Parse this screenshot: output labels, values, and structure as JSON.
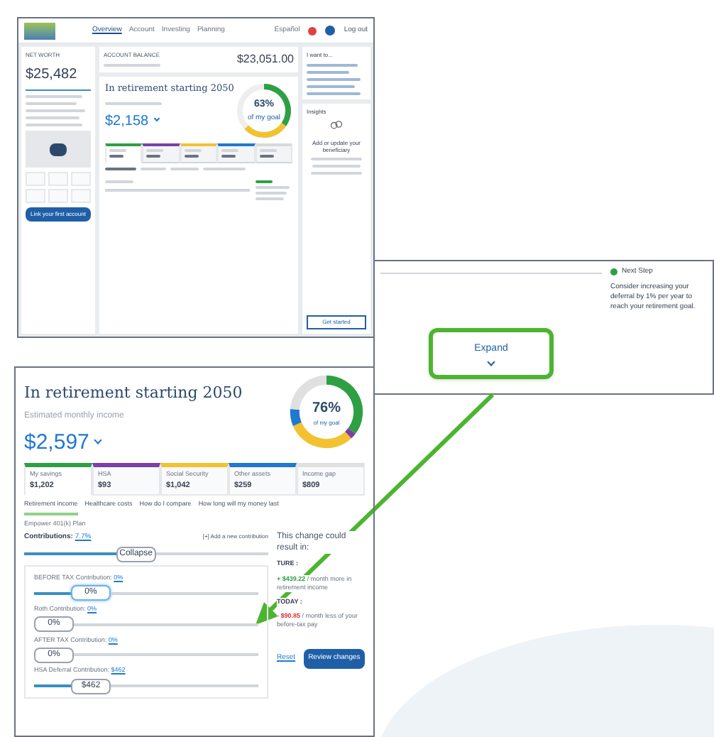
{
  "top_screenshot": {
    "nav": [
      {
        "label": "Overview",
        "selected": true
      },
      {
        "label": "Account",
        "selected": false
      },
      {
        "label": "Investing",
        "selected": false
      },
      {
        "label": "Planning",
        "selected": false
      }
    ],
    "language": "Español",
    "logout": "Log out",
    "net_worth": {
      "label": "NET WORTH",
      "value": "$25,482"
    },
    "link_button": "Link your first account",
    "balance": {
      "label": "ACCOUNT BALANCE",
      "value": "$23,051.00"
    },
    "retirement": {
      "title": "In retirement starting 2050",
      "amount": "$2,158",
      "percent": "63%",
      "goal": "of my goal"
    },
    "summary_tabs": [
      {
        "color": "#2ea043",
        "selected": true
      },
      {
        "color": "#7b3fa8",
        "selected": false
      },
      {
        "color": "#f2c230",
        "selected": false
      },
      {
        "color": "#1f78d1",
        "selected": false
      },
      {
        "color": "#d9d9d9",
        "selected": false
      }
    ],
    "side": {
      "want_title": "I want to...",
      "insights": "Insights",
      "headline": "Add or update your beneficiary",
      "button": "Get started"
    }
  },
  "detail_screenshot": {
    "next_step": "Next Step",
    "advice": "Consider increasing your deferral by 1% per year to reach your retirement goal.",
    "expand": "Expand",
    "highlighted": true
  },
  "zoom_screenshot": {
    "title": "In retirement starting 2050",
    "subtitle": "Estimated monthly income",
    "amount": "$2,597",
    "percent": "76%",
    "goal": "of my goal",
    "categories": [
      {
        "label": "My savings",
        "value": "$1,202",
        "color": "#2ea043",
        "selected": true
      },
      {
        "label": "HSA",
        "value": "$93",
        "color": "#7b3fa8",
        "selected": false
      },
      {
        "label": "Social Security",
        "value": "$1,042",
        "color": "#f2c230",
        "selected": false
      },
      {
        "label": "Other assets",
        "value": "$259",
        "color": "#1f78d1",
        "selected": false
      },
      {
        "label": "Income gap",
        "value": "$809",
        "color": "#e0e0e0",
        "selected": false
      }
    ],
    "tabs": [
      {
        "label": "Retirement income",
        "selected": true
      },
      {
        "label": "Healthcare costs",
        "selected": false
      },
      {
        "label": "How do I compare",
        "selected": false
      },
      {
        "label": "How long will my money last",
        "selected": false
      }
    ],
    "plan": "Empower 401(k) Plan",
    "contributions_label": "Contributions:",
    "contributions_value": "7.7%",
    "add_contribution": "[+] Add a new contribution",
    "collapse": {
      "label": "Collapse",
      "level": 0.45
    },
    "sliders": [
      {
        "label": "BEFORE TAX Contribution:",
        "value": "0%",
        "thumb": "0%",
        "level": 0.2,
        "focused": true
      },
      {
        "label": "Roth Contribution:",
        "value": "0%",
        "thumb": "0%",
        "level": 0,
        "focused": false
      },
      {
        "label": "AFTER TAX Contribution:",
        "value": "0%",
        "thumb": "0%",
        "level": 0,
        "focused": false
      },
      {
        "label": "HSA Deferral Contribution:",
        "value": "$462",
        "thumb": "$462",
        "level": 0.2,
        "focused": false
      }
    ],
    "result_title": "This change could result in:",
    "future_label": "TURE :",
    "future_amount": "+ $439.22",
    "future_text": "/ month more in retirement income",
    "today_label": "TODAY :",
    "today_amount": "- $90.85",
    "today_text": "/ month less of your before-tax pay",
    "reset": "Reset",
    "review": "Review changes"
  }
}
